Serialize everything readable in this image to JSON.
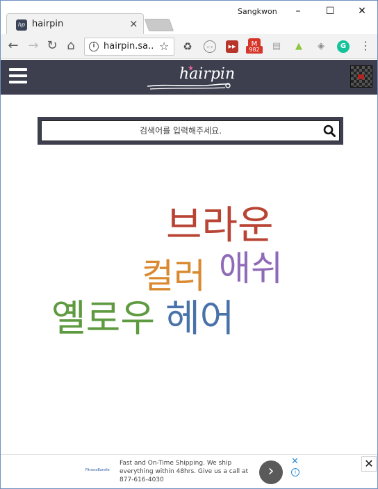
{
  "browser": {
    "tab_title": "hairpin",
    "favicon_text": "hp",
    "tab_close": "×",
    "profile_name": "Sangkwon",
    "window_controls": {
      "minimize": "–",
      "maximize": "☐",
      "close": "✕"
    },
    "nav": {
      "back": "←",
      "forward": "→",
      "reload": "↻",
      "home": "⌂"
    },
    "url": "hairpin.sa...",
    "info_icon": "i",
    "bookmark_star": "☆",
    "extensions": [
      {
        "name": "recycle-extension",
        "glyph": "♻",
        "color": "#4a4a4a"
      },
      {
        "name": "code-extension",
        "glyph": "‹·›",
        "color": "#9a9a9a"
      },
      {
        "name": "forward-extension",
        "glyph": "▶▶",
        "color": "#b8352b"
      },
      {
        "name": "mail-extension",
        "glyph": "M",
        "color": "#d6352a",
        "badge": "982"
      },
      {
        "name": "page-extension",
        "glyph": "▤",
        "color": "#bdbdbd"
      },
      {
        "name": "android-extension",
        "glyph": "▲",
        "color": "#8dc63f"
      },
      {
        "name": "cube-extension",
        "glyph": "◈",
        "color": "#8a8a8a"
      },
      {
        "name": "grammarly-extension",
        "glyph": "G",
        "color": "#15c39a"
      }
    ],
    "menu_icon": "⋮"
  },
  "site": {
    "logo_text": "hairpin",
    "colors": {
      "header": "#3d3f4f",
      "accent_pink": "#e8679c"
    }
  },
  "search": {
    "placeholder": "검색어를 입력해주세요."
  },
  "word_cloud": [
    {
      "text": "브라운",
      "color": "#b84434"
    },
    {
      "text": "컬러",
      "color": "#d98930"
    },
    {
      "text": "애쉬",
      "color": "#8e6ab8"
    },
    {
      "text": "옐로우",
      "color": "#5e9a3f"
    },
    {
      "text": "헤어",
      "color": "#4a72aa"
    }
  ],
  "ad": {
    "logo_text": "FitnessBundle",
    "text": "Fast and On-Time Shipping. We ship everything within 48hrs. Give us a call at 877-616-4030",
    "next": "›",
    "x_label": "✕",
    "info": "i",
    "close": "✕"
  }
}
